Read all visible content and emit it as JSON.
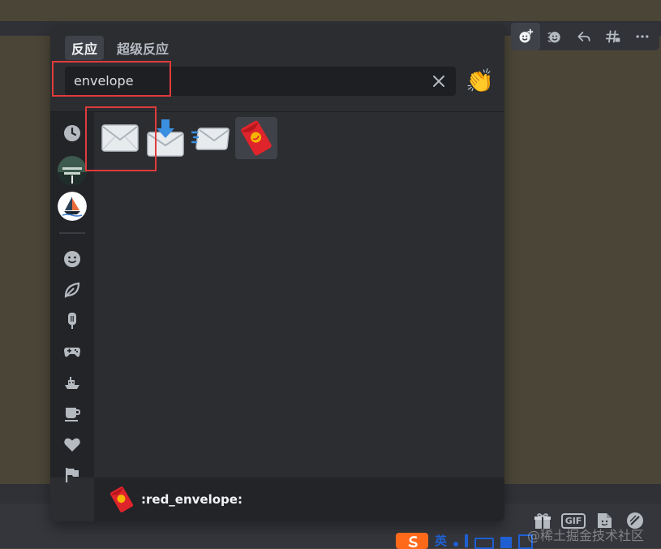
{
  "toolbar": {
    "buttons": [
      {
        "icon": "add-reaction-icon",
        "active": true
      },
      {
        "icon": "add-super-reaction-icon"
      },
      {
        "icon": "reply-icon"
      },
      {
        "icon": "create-thread-icon"
      },
      {
        "icon": "more-icon"
      }
    ]
  },
  "picker": {
    "tabs": [
      {
        "label": "反应",
        "selected": true
      },
      {
        "label": "超级反应",
        "selected": false
      }
    ],
    "search": {
      "value": "envelope"
    },
    "skin_tone_emoji": "👏",
    "sidebar": {
      "top": [
        "recent-icon",
        "server-avatar",
        "server-avatar-boat"
      ],
      "categories": [
        "smile-icon",
        "leaf-icon",
        "ice-pop-icon",
        "gamepad-icon",
        "travel-icon",
        "coffee-icon",
        "heart-icon",
        "flag-icon"
      ]
    },
    "results": [
      {
        "emoji": "✉️",
        "name": "envelope"
      },
      {
        "emoji": "📩",
        "name": "envelope_with_arrow"
      },
      {
        "emoji": "📨",
        "name": "incoming_envelope"
      },
      {
        "emoji": "🧧",
        "name": "red_envelope",
        "hovered": true
      }
    ],
    "footer": {
      "emoji": "🧧",
      "label": ":red_envelope:"
    }
  },
  "chat_tools": {
    "gif_label": "GIF"
  },
  "ime": {
    "glyph": "英"
  },
  "watermark": "@稀土掘金技术社区",
  "colors": {
    "annotation": "#e03b3b",
    "background": "#4a4537",
    "picker": "#2b2d31"
  }
}
